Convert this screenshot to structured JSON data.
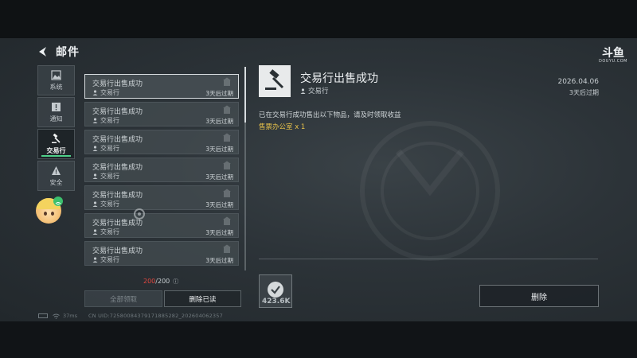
{
  "header": {
    "title": "邮件"
  },
  "watermark": {
    "main": "斗鱼",
    "sub": "DOUYU.COM"
  },
  "categories": [
    {
      "label": "系统",
      "icon": "image-icon",
      "active": false
    },
    {
      "label": "通知",
      "icon": "alert-icon",
      "active": false
    },
    {
      "label": "交易行",
      "icon": "gavel-icon",
      "active": true
    },
    {
      "label": "安全",
      "icon": "warning-icon",
      "active": false
    }
  ],
  "mails": [
    {
      "title": "交易行出售成功",
      "sender": "交易行",
      "expire": "3天后过期",
      "selected": true
    },
    {
      "title": "交易行出售成功",
      "sender": "交易行",
      "expire": "3天后过期",
      "selected": false
    },
    {
      "title": "交易行出售成功",
      "sender": "交易行",
      "expire": "3天后过期",
      "selected": false
    },
    {
      "title": "交易行出售成功",
      "sender": "交易行",
      "expire": "3天后过期",
      "selected": false
    },
    {
      "title": "交易行出售成功",
      "sender": "交易行",
      "expire": "3天后过期",
      "selected": false
    },
    {
      "title": "交易行出售成功",
      "sender": "交易行",
      "expire": "3天后过期",
      "selected": false
    },
    {
      "title": "交易行出售成功",
      "sender": "交易行",
      "expire": "3天后过期",
      "selected": false
    }
  ],
  "mail_count": {
    "current": "200",
    "total": "/200"
  },
  "buttons": {
    "collect_all": "全部领取",
    "delete_read": "删除已读",
    "delete": "删除"
  },
  "detail": {
    "title": "交易行出售成功",
    "sender": "交易行",
    "date": "2026.04.06",
    "expire": "3天后过期",
    "body": "已在交易行成功售出以下物品，请及时领取收益",
    "reward": "售票办公室 x 1",
    "attachment_count": "423.6K"
  },
  "status": {
    "latency": "37ms",
    "uid": "CN UID:72580084379171885282_202604062357"
  },
  "colors": {
    "active_tab": "#4fd08a",
    "count_warning": "#e0473f",
    "reward": "#e8c24a"
  }
}
